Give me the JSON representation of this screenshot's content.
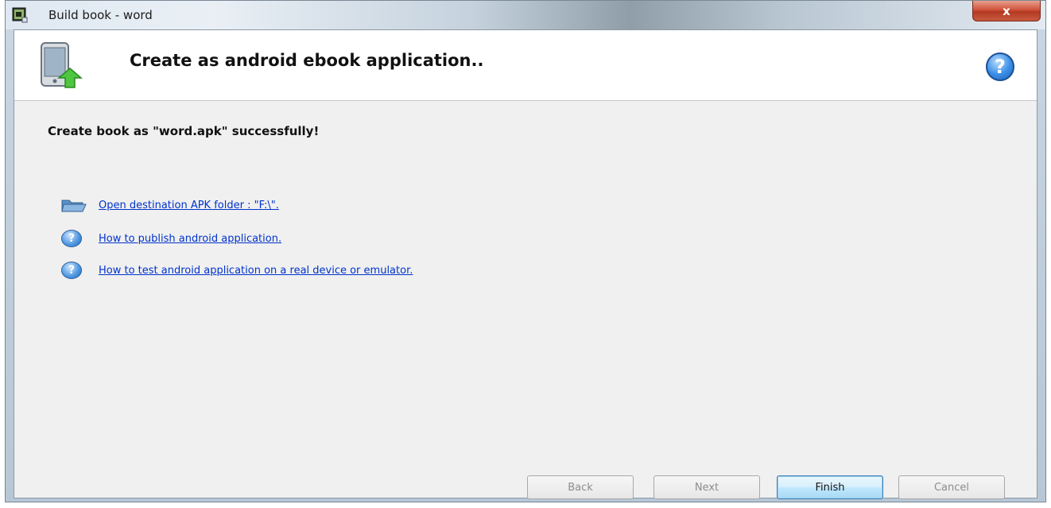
{
  "window": {
    "title": "Build book - word",
    "close_label": "x"
  },
  "header": {
    "title": "Create as android ebook application..",
    "help_label": "?"
  },
  "status": {
    "message": "Create book as \"word.apk\" successfully!"
  },
  "links": [
    {
      "label": "Open destination APK folder : \"F:\\\".",
      "icon": "folder-icon"
    },
    {
      "label": "How to publish android application.",
      "icon": "help-icon"
    },
    {
      "label": "How to test android application on a real device or emulator.",
      "icon": "help-icon"
    }
  ],
  "buttons": {
    "back": {
      "label": "Back",
      "enabled": false
    },
    "next": {
      "label": "Next",
      "enabled": false
    },
    "finish": {
      "label": "Finish",
      "enabled": true
    },
    "cancel": {
      "label": "Cancel",
      "enabled": false
    }
  },
  "colors": {
    "link": "#0033cc",
    "close": "#c8462c",
    "accent": "#3a8ee6"
  }
}
